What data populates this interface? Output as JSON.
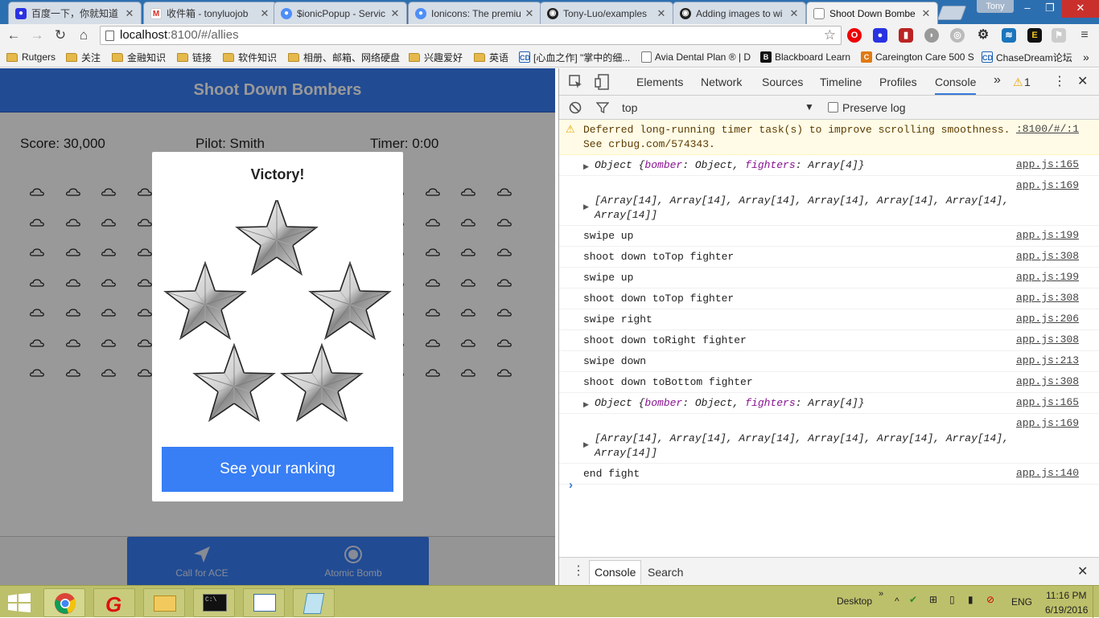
{
  "tabs": [
    {
      "title": "百度一下，你就知道",
      "icon": "baidu-paw-icon"
    },
    {
      "title": "收件箱 - tonyluojob",
      "icon": "gmail-icon"
    },
    {
      "title": "$ionicPopup - Servic",
      "icon": "ionic-icon"
    },
    {
      "title": "Ionicons: The premiu",
      "icon": "ionic-icon"
    },
    {
      "title": "Tony-Luo/examples",
      "icon": "github-icon"
    },
    {
      "title": "Adding images to wi",
      "icon": "github-icon"
    },
    {
      "title": "Shoot Down Bombe",
      "icon": "page-icon"
    }
  ],
  "profile_name": "Tony",
  "address": {
    "host": "localhost",
    "path": ":8100/#/allies"
  },
  "bookmarks": [
    {
      "label": "Rutgers",
      "type": "folder"
    },
    {
      "label": "关注",
      "type": "folder"
    },
    {
      "label": "金融知识",
      "type": "folder"
    },
    {
      "label": "链接",
      "type": "folder"
    },
    {
      "label": "软件知识",
      "type": "folder"
    },
    {
      "label": "相册、邮箱、网络硬盘",
      "type": "folder"
    },
    {
      "label": "兴趣爱好",
      "type": "folder"
    },
    {
      "label": "英语",
      "type": "folder"
    },
    {
      "label": "[心血之作] \"掌中的细...",
      "type": "site",
      "icon": "cd-icon"
    },
    {
      "label": "Avia Dental Plan ® | D",
      "type": "site",
      "icon": "page-icon"
    },
    {
      "label": "Blackboard Learn",
      "type": "site",
      "icon": "blackboard-icon"
    },
    {
      "label": "Careington Care 500 S",
      "type": "site",
      "icon": "careington-icon"
    },
    {
      "label": "ChaseDream论坛",
      "type": "site",
      "icon": "cd-icon"
    }
  ],
  "app": {
    "title": "Shoot Down Bombers",
    "score": "Score: 30,000",
    "pilot": "Pilot: Smith",
    "timer": "Timer: 0:00",
    "footer": {
      "ace_label": "Call for ACE",
      "bomb_label": "Atomic Bomb"
    },
    "popup": {
      "title": "Victory!",
      "button": "See your ranking"
    }
  },
  "devtools": {
    "tabs": [
      "Elements",
      "Network",
      "Sources",
      "Timeline",
      "Profiles",
      "Console"
    ],
    "warning_count": "1",
    "context": "top",
    "preserve_log": "Preserve log",
    "drawer_tabs": [
      "Console",
      "Search"
    ],
    "log": [
      {
        "type": "warn",
        "text": "Deferred long-running timer task(s) to improve scrolling smoothness. See crbug.com/574343.",
        "src": ":8100/#/:1"
      },
      {
        "type": "object",
        "text": "Object {bomber: Object, fighters: Array[4]}",
        "src": "app.js:165"
      },
      {
        "type": "array",
        "text": "[Array[14], Array[14], Array[14], Array[14], Array[14], Array[14], Array[14]]",
        "src": "app.js:169"
      },
      {
        "type": "log",
        "text": "swipe up",
        "src": "app.js:199"
      },
      {
        "type": "log",
        "text": "shoot down toTop fighter",
        "src": "app.js:308"
      },
      {
        "type": "log",
        "text": "swipe up",
        "src": "app.js:199"
      },
      {
        "type": "log",
        "text": "shoot down toTop fighter",
        "src": "app.js:308"
      },
      {
        "type": "log",
        "text": "swipe right",
        "src": "app.js:206"
      },
      {
        "type": "log",
        "text": "shoot down toRight fighter",
        "src": "app.js:308"
      },
      {
        "type": "log",
        "text": "swipe down",
        "src": "app.js:213"
      },
      {
        "type": "log",
        "text": "shoot down toBottom fighter",
        "src": "app.js:308"
      },
      {
        "type": "object",
        "text": "Object {bomber: Object, fighters: Array[4]}",
        "src": "app.js:165"
      },
      {
        "type": "array",
        "text": "[Array[14], Array[14], Array[14], Array[14], Array[14], Array[14], Array[14]]",
        "src": "app.js:169"
      },
      {
        "type": "log",
        "text": "end fight",
        "src": "app.js:140"
      }
    ]
  },
  "taskbar": {
    "desktop": "Desktop",
    "lang": "ENG",
    "time": "11:16 PM",
    "date": "6/19/2016"
  }
}
